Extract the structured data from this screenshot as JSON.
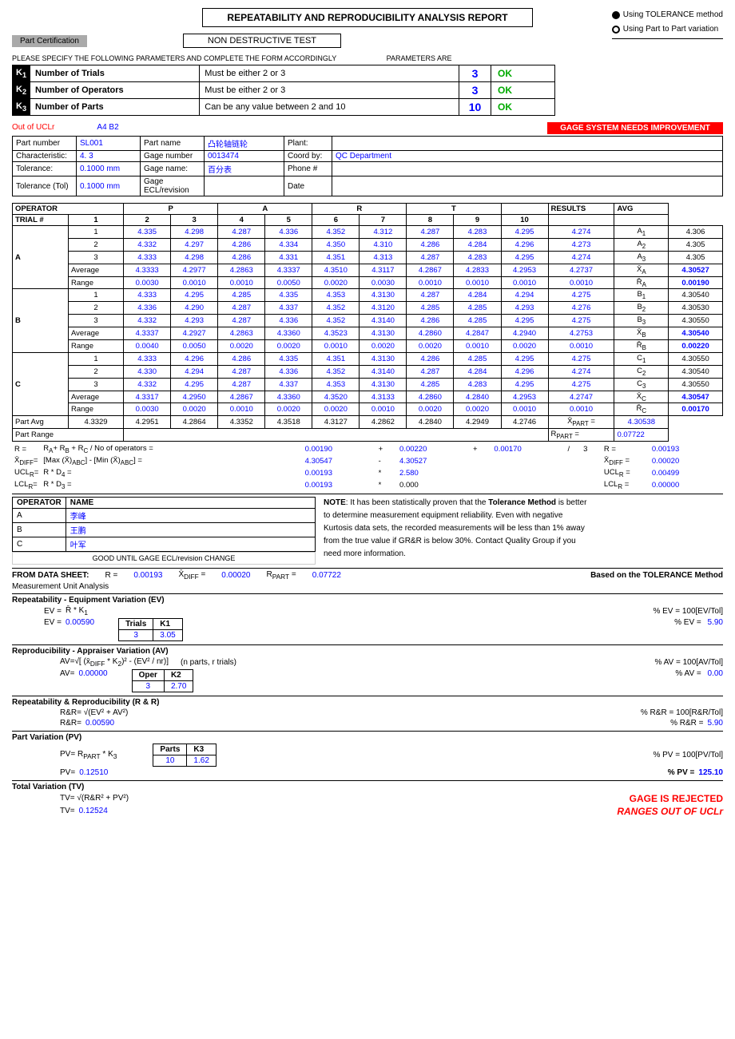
{
  "header": {
    "title": "REPEATABILITY AND REPRODUCIBILITY ANALYSIS REPORT",
    "tolerance_method": "Using TOLERANCE method",
    "part_variation": "Using Part to Part variation"
  },
  "sub_header": {
    "part_cert": "Part Certification",
    "ndt": "NON DESTRUCTIVE TEST"
  },
  "params_note1": "PLEASE SPECIFY THE FOLLOWING PARAMETERS AND COMPLETE THE FORM ACCORDINGLY",
  "params_note2": "PARAMETERS ARE",
  "parameters": [
    {
      "key": "K1",
      "label": "Number of Trials",
      "constraint": "Must be either 2 or 3",
      "value": "3",
      "status": "OK"
    },
    {
      "key": "K2",
      "label": "Number of Operators",
      "constraint": "Must be either 2 or 3",
      "value": "3",
      "status": "OK"
    },
    {
      "key": "K3",
      "label": "Number of Parts",
      "constraint": "Can be any value between 2 and 10",
      "value": "10",
      "status": "OK"
    }
  ],
  "gage_header": {
    "out_ucl": "Out of UCLr",
    "a4b2": "A4 B2",
    "needs_improvement": "GAGE SYSTEM NEEDS IMPROVEMENT"
  },
  "gage_info": {
    "part_number_label": "Part number",
    "part_number_val": "SL001",
    "characteristic_label": "Characteristic:",
    "characteristic_val": "4. 3",
    "tolerance_label": "Tolerance:",
    "tolerance_val": "0.1000",
    "tolerance_unit": "mm",
    "tolerance_tol_label": "Tolerance (Tol)",
    "tolerance_tol_val": "0.1000",
    "tolerance_tol_unit": "mm",
    "part_name_label": "Part name",
    "part_name_val": "凸轮轴链轮",
    "gage_number_label": "Gage number",
    "gage_number_val": "0013474",
    "gage_name_label": "Gage name:",
    "gage_name_val": "百分表",
    "gage_ecl_label": "Gage ECL/revision",
    "plant_label": "Plant:",
    "coord_label": "Coord by:",
    "coord_val": "QC Department",
    "phone_label": "Phone #",
    "date_label": "Date"
  },
  "operators": [
    "P",
    "A",
    "R",
    "T"
  ],
  "trial_cols": [
    "1",
    "2",
    "3",
    "4",
    "5",
    "6",
    "7",
    "8",
    "9",
    "10"
  ],
  "data": {
    "A": {
      "trials": [
        [
          4.335,
          4.298,
          4.287,
          4.336,
          4.352,
          4.312,
          4.287,
          4.283,
          4.295,
          4.274
        ],
        [
          4.332,
          4.297,
          4.286,
          4.334,
          4.35,
          4.31,
          4.286,
          4.284,
          4.296,
          4.273
        ],
        [
          4.333,
          4.298,
          4.286,
          4.331,
          4.351,
          4.313,
          4.287,
          4.283,
          4.295,
          4.274
        ]
      ],
      "average": [
        4.3333,
        4.2977,
        4.2863,
        4.3337,
        4.351,
        4.3117,
        4.2867,
        4.2833,
        4.2953,
        4.2737
      ],
      "range": [
        0.003,
        0.001,
        0.001,
        0.005,
        0.002,
        0.003,
        0.001,
        0.001,
        0.001,
        0.001
      ],
      "xbar": "4.30527",
      "rbar": "0.00190",
      "results": [
        "A1",
        "A2",
        "A3"
      ],
      "result_vals": [
        "4.306",
        "4.305",
        "4.305"
      ]
    },
    "B": {
      "trials": [
        [
          4.333,
          4.295,
          4.285,
          4.335,
          4.353,
          4.313,
          4.287,
          4.284,
          4.294,
          4.275
        ],
        [
          4.336,
          4.29,
          4.287,
          4.337,
          4.352,
          4.312,
          4.285,
          4.285,
          4.293,
          4.276
        ],
        [
          4.332,
          4.293,
          4.287,
          4.336,
          4.352,
          4.314,
          4.286,
          4.285,
          4.295,
          4.275
        ]
      ],
      "average": [
        4.3337,
        4.2927,
        4.2863,
        4.336,
        4.3523,
        4.313,
        4.286,
        4.2847,
        4.294,
        4.2753
      ],
      "range": [
        0.004,
        0.005,
        0.002,
        0.002,
        0.001,
        0.002,
        0.002,
        0.001,
        0.002,
        0.001
      ],
      "xbar": "4.30540",
      "rbar": "0.00220",
      "results": [
        "B1",
        "B2",
        "B3"
      ],
      "result_vals": [
        "4.30540",
        "4.30530",
        "4.30550"
      ]
    },
    "C": {
      "trials": [
        [
          4.333,
          4.296,
          4.286,
          4.335,
          4.351,
          4.313,
          4.286,
          4.285,
          4.295,
          4.275
        ],
        [
          4.33,
          4.294,
          4.287,
          4.336,
          4.352,
          4.314,
          4.287,
          4.284,
          4.296,
          4.274
        ],
        [
          4.332,
          4.295,
          4.287,
          4.337,
          4.353,
          4.313,
          4.285,
          4.283,
          4.295,
          4.275
        ]
      ],
      "average": [
        4.3317,
        4.295,
        4.2867,
        4.336,
        4.352,
        4.3133,
        4.286,
        4.284,
        4.2953,
        4.2747
      ],
      "range": [
        0.003,
        0.002,
        0.001,
        0.002,
        0.002,
        0.001,
        0.002,
        0.002,
        0.001,
        0.001
      ],
      "xbar": "4.30547",
      "rbar": "0.00170",
      "results": [
        "C1",
        "C2",
        "C3"
      ],
      "result_vals": [
        "4.30550",
        "4.30540",
        "4.30550"
      ]
    }
  },
  "part_avg": [
    4.3329,
    4.2951,
    4.2864,
    4.3352,
    4.3518,
    4.3127,
    4.2862,
    4.284,
    4.2949,
    4.2746
  ],
  "x_part_avg": "4.30538",
  "part_range_label": "Part Range",
  "r_part": "0.07722",
  "formulas": {
    "r_formula": "RA+ RB + RC / No of operators =",
    "r_val": "0.00190",
    "plus1": "+",
    "val1": "0.00220",
    "plus2": "+",
    "val2": "0.00170",
    "div": "/",
    "div_val": "3",
    "r_result": "0.00193",
    "xdiff_formula": "[Max (X)ABC]",
    "xdiff_minus": "-",
    "xdiff_min": "[Min (X)ABC]",
    "xdiff_eq": "=",
    "xdiff_val1": "4.30547",
    "xdiff_sub": "-",
    "xdiff_val2": "4.30527",
    "xdiff_result": "0.00020",
    "ucl_r_label": "UCLR=",
    "ucl_r_val": "0.00499",
    "ucl_r_formula_r": "R",
    "ucl_r_star": "*",
    "ucl_r_d4": "D4 =",
    "ucl_r_d4_val": "0.00193",
    "ucl_r_star2": "*",
    "ucl_r_num": "2.580",
    "lcl_r_label": "LCLR=",
    "lcl_r_val": "0.00000",
    "lcl_r_formula_r": "R",
    "lcl_r_star": "*",
    "lcl_r_d3": "D3 =",
    "lcl_r_d3_val": "0.00193",
    "lcl_r_star2": "*",
    "lcl_r_num": "0.000"
  },
  "operator_names": {
    "label": "NAME",
    "A": "李峰",
    "B": "王鹏",
    "C": "叶军",
    "good_until": "GOOD UNTIL GAGE ECL/revision CHANGE"
  },
  "note": {
    "text1": "NOTE: It has been statistically proven that the Tolerance Method is better",
    "text2": "to determine measurement equipment reliability. Even with negative",
    "text3": "Kurtosis data sets, the recorded measurements will be less than 1% away",
    "text4": "from the true value if GR&R is below 30%. Contact Quality Group if you",
    "text5": "need more information."
  },
  "from_data": {
    "label": "FROM DATA SHEET:",
    "r_label": "R =",
    "r_val": "0.00193",
    "xdiff_label": "XDIFF =",
    "xdiff_val": "0.00020",
    "rpart_label": "RPART =",
    "rpart_val": "0.07722"
  },
  "mua": {
    "label": "Measurement Unit Analysis",
    "based_on": "Based on the TOLERANCE Method"
  },
  "ev": {
    "section": "Repeatability - Equipment Variation (EV)",
    "formula1": "EV =",
    "formula2_bar": "R",
    "formula2_rest": "* K1",
    "ev_val": "0.00590",
    "pct_label": "% EV = 100[EV/Tol]",
    "pct_val_label": "% EV =",
    "pct_val": "5.90",
    "trials_label": "Trials",
    "k1_label": "K1",
    "trials_val": "3",
    "k1_val": "3.05"
  },
  "av": {
    "section": "Reproducibility - Appraiser Variation (AV)",
    "formula": "AV=√[ (x̄DIFF * K2)² - (EV² / nr)]",
    "n_parts": "(n parts, r trials)",
    "av_val": "0.00000",
    "pct_label": "% AV = 100[AV/Tol]",
    "pct_val_label": "% AV =",
    "pct_val": "0.00",
    "oper_label": "Oper",
    "k2_label": "K2",
    "oper_val": "3",
    "k2_val": "2.70"
  },
  "rnr": {
    "section": "Repeatability & Reproducibility (R & R)",
    "formula": "R&R= √(EV² + AV²)",
    "rnr_val": "0.00590",
    "pct_label": "% R&R = 100[R&R/Tol]",
    "pct_val_label": "% R&R =",
    "pct_val": "5.90"
  },
  "pv": {
    "section": "Part Variation (PV)",
    "formula": "PV= RPART * K3",
    "pv_val": "0.12510",
    "pct_label": "% PV = 100[PV/Tol]",
    "pct_val_label": "% PV =",
    "pct_val": "125.10",
    "parts_label": "Parts",
    "k3_label": "K3",
    "parts_val": "10",
    "k3_val": "1.62"
  },
  "tv": {
    "section": "Total Variation (TV)",
    "formula": "TV= √(R&R² + PV²)",
    "tv_val": "0.12524",
    "rejected": "GAGE IS REJECTED",
    "ranges": "RANGES OUT OF UCLr"
  }
}
